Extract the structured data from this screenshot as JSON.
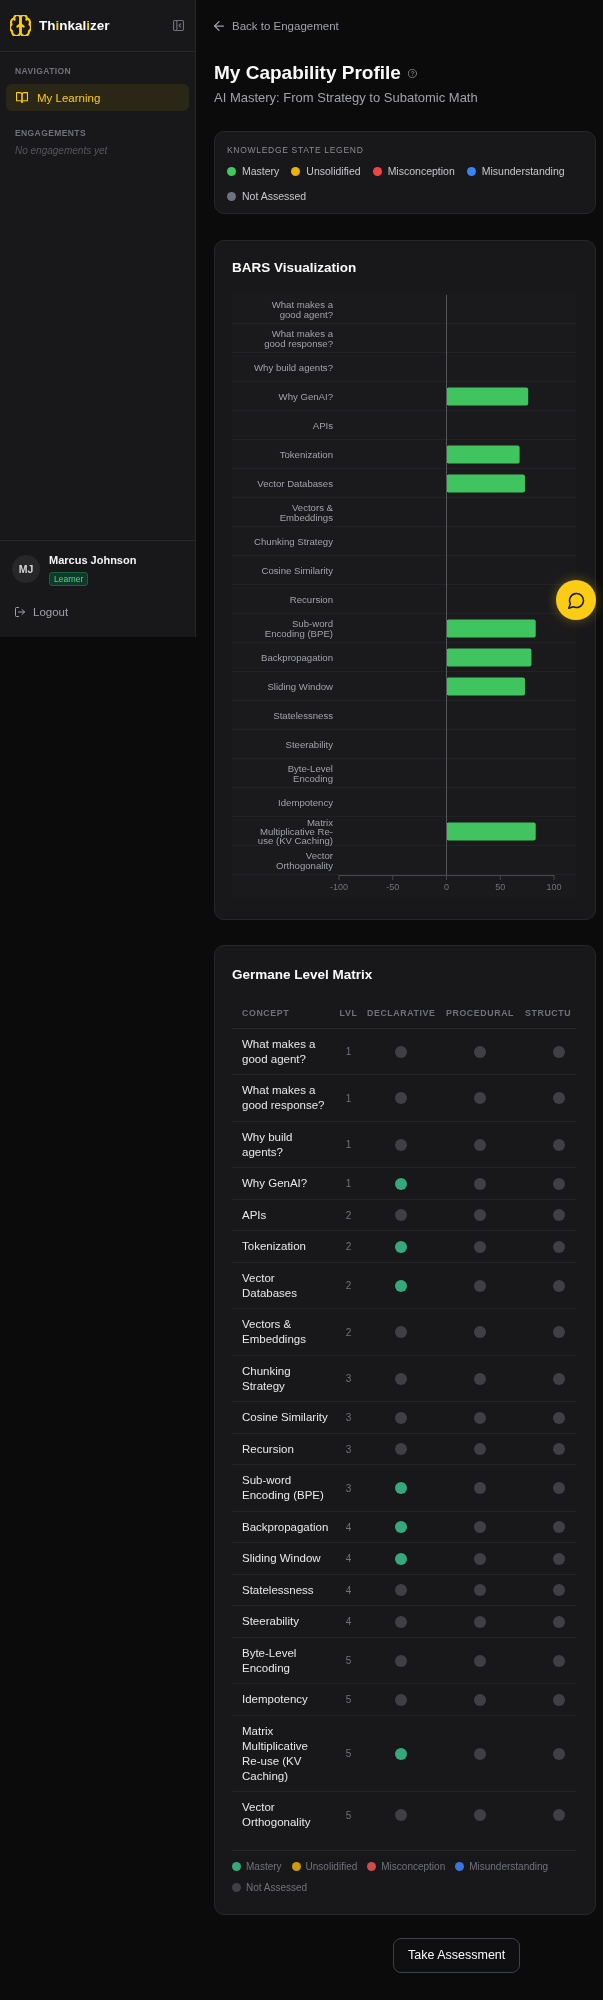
{
  "sidebar": {
    "brand": {
      "segments": [
        {
          "text": "Th",
          "accent": false
        },
        {
          "text": "i",
          "accent": true
        },
        {
          "text": "nkal",
          "accent": false
        },
        {
          "text": "i",
          "accent": true
        },
        {
          "text": "zer",
          "accent": false
        }
      ]
    },
    "nav_heading": "NAVIGATION",
    "nav_items": [
      {
        "label": "My Learning",
        "selected": true
      }
    ],
    "engagements_heading": "ENGAGEMENTS",
    "engagements_empty": "No engagements yet",
    "user": {
      "initials": "MJ",
      "name": "Marcus Johnson",
      "role": "Learner"
    },
    "logout": "Logout"
  },
  "back_link": "Back to Engagement",
  "header": {
    "title": "My Capability Profile",
    "subtitle": "AI Mastery: From Strategy to Subatomic Math"
  },
  "legend": {
    "title": "KNOWLEDGE STATE LEGEND",
    "items": [
      {
        "label": "Mastery",
        "color": "#3fca5e"
      },
      {
        "label": "Unsolidified",
        "color": "#eab308"
      },
      {
        "label": "Misconception",
        "color": "#ef4444"
      },
      {
        "label": "Misunderstanding",
        "color": "#3b82f6"
      },
      {
        "label": "Not Assessed",
        "color": "#6b7280"
      }
    ]
  },
  "bars_card": {
    "title": "BARS Visualization",
    "chart_data": {
      "type": "bar",
      "orientation": "horizontal",
      "categories": [
        "What makes a good agent?",
        "What makes a good response?",
        "Why build agents?",
        "Why GenAI?",
        "APIs",
        "Tokenization",
        "Vector Databases",
        "Vectors & Embeddings",
        "Chunking Strategy",
        "Cosine Similarity",
        "Recursion",
        "Sub-word Encoding (BPE)",
        "Backpropagation",
        "Sliding Window",
        "Statelessness",
        "Steerability",
        "Byte-Level Encoding",
        "Idempotency",
        "Matrix Multiplicative Re-use (KV Caching)",
        "Vector Orthogonality"
      ],
      "series": [
        {
          "color": "#40c45f",
          "values": [
            null,
            null,
            null,
            76,
            null,
            68,
            73,
            null,
            null,
            null,
            null,
            83,
            79,
            73,
            null,
            null,
            null,
            null,
            83,
            null
          ]
        }
      ],
      "xlim": [
        -100,
        100
      ],
      "xticks": [
        -100,
        -50,
        0,
        50,
        100
      ]
    }
  },
  "matrix": {
    "title": "Germane Level Matrix",
    "columns": [
      "CONCEPT",
      "LVL",
      "DECLARATIVE",
      "PROCEDURAL",
      "STRUCTU"
    ],
    "rows": [
      {
        "concept": "What makes a good agent?",
        "lvl": "1",
        "cells": [
          {
            "color": "#3f3f46"
          },
          {
            "color": "#3f3f46"
          },
          {
            "color": "#3f3f46"
          }
        ]
      },
      {
        "concept": "What makes a good response?",
        "lvl": "1",
        "cells": [
          {
            "color": "#3f3f46"
          },
          {
            "color": "#3f3f46"
          },
          {
            "color": "#3f3f46"
          }
        ]
      },
      {
        "concept": "Why build agents?",
        "lvl": "1",
        "cells": [
          {
            "color": "#3f3f46"
          },
          {
            "color": "#3f3f46"
          },
          {
            "color": "#3f3f46"
          }
        ]
      },
      {
        "concept": "Why GenAI?",
        "lvl": "1",
        "cells": [
          {
            "color": "#36a97c"
          },
          {
            "color": "#3f3f46"
          },
          {
            "color": "#3f3f46"
          }
        ]
      },
      {
        "concept": "APIs",
        "lvl": "2",
        "cells": [
          {
            "color": "#3f3f46"
          },
          {
            "color": "#3f3f46"
          },
          {
            "color": "#3f3f46"
          }
        ]
      },
      {
        "concept": "Tokenization",
        "lvl": "2",
        "cells": [
          {
            "color": "#36a97c"
          },
          {
            "color": "#3f3f46"
          },
          {
            "color": "#3f3f46"
          }
        ]
      },
      {
        "concept": "Vector Databases",
        "lvl": "2",
        "cells": [
          {
            "color": "#36a97c"
          },
          {
            "color": "#3f3f46"
          },
          {
            "color": "#3f3f46"
          }
        ]
      },
      {
        "concept": "Vectors & Embeddings",
        "lvl": "2",
        "cells": [
          {
            "color": "#3f3f46"
          },
          {
            "color": "#3f3f46"
          },
          {
            "color": "#3f3f46"
          }
        ]
      },
      {
        "concept": "Chunking Strategy",
        "lvl": "3",
        "cells": [
          {
            "color": "#3f3f46"
          },
          {
            "color": "#3f3f46"
          },
          {
            "color": "#3f3f46"
          }
        ]
      },
      {
        "concept": "Cosine Similarity",
        "lvl": "3",
        "cells": [
          {
            "color": "#3f3f46"
          },
          {
            "color": "#3f3f46"
          },
          {
            "color": "#3f3f46"
          }
        ]
      },
      {
        "concept": "Recursion",
        "lvl": "3",
        "cells": [
          {
            "color": "#3f3f46"
          },
          {
            "color": "#3f3f46"
          },
          {
            "color": "#3f3f46"
          }
        ]
      },
      {
        "concept": "Sub-word Encoding (BPE)",
        "lvl": "3",
        "cells": [
          {
            "color": "#36a97c"
          },
          {
            "color": "#3f3f46"
          },
          {
            "color": "#3f3f46"
          }
        ]
      },
      {
        "concept": "Backpropagation",
        "lvl": "4",
        "cells": [
          {
            "color": "#36a97c"
          },
          {
            "color": "#3f3f46"
          },
          {
            "color": "#3f3f46"
          }
        ]
      },
      {
        "concept": "Sliding Window",
        "lvl": "4",
        "cells": [
          {
            "color": "#36a97c"
          },
          {
            "color": "#3f3f46"
          },
          {
            "color": "#3f3f46"
          }
        ]
      },
      {
        "concept": "Statelessness",
        "lvl": "4",
        "cells": [
          {
            "color": "#3f3f46"
          },
          {
            "color": "#3f3f46"
          },
          {
            "color": "#3f3f46"
          }
        ]
      },
      {
        "concept": "Steerability",
        "lvl": "4",
        "cells": [
          {
            "color": "#3f3f46"
          },
          {
            "color": "#3f3f46"
          },
          {
            "color": "#3f3f46"
          }
        ]
      },
      {
        "concept": "Byte-Level Encoding",
        "lvl": "5",
        "cells": [
          {
            "color": "#3f3f46"
          },
          {
            "color": "#3f3f46"
          },
          {
            "color": "#3f3f46"
          }
        ]
      },
      {
        "concept": "Idempotency",
        "lvl": "5",
        "cells": [
          {
            "color": "#3f3f46"
          },
          {
            "color": "#3f3f46"
          },
          {
            "color": "#3f3f46"
          }
        ]
      },
      {
        "concept": "Matrix Multiplicative Re-use (KV Caching)",
        "lvl": "5",
        "cells": [
          {
            "color": "#36a97c"
          },
          {
            "color": "#3f3f46"
          },
          {
            "color": "#3f3f46"
          }
        ]
      },
      {
        "concept": "Vector Orthogonality",
        "lvl": "5",
        "cells": [
          {
            "color": "#3f3f46"
          },
          {
            "color": "#3f3f46"
          },
          {
            "color": "#3f3f46"
          }
        ]
      }
    ],
    "legend": [
      {
        "label": "Mastery",
        "color": "#36a97c"
      },
      {
        "label": "Unsolidified",
        "color": "#c99a12"
      },
      {
        "label": "Misconception",
        "color": "#d24a4a"
      },
      {
        "label": "Misunderstanding",
        "color": "#3d74d9"
      },
      {
        "label": "Not Assessed",
        "color": "#3f3f46"
      }
    ]
  },
  "actions": {
    "take_assessment": "Take Assessment"
  }
}
